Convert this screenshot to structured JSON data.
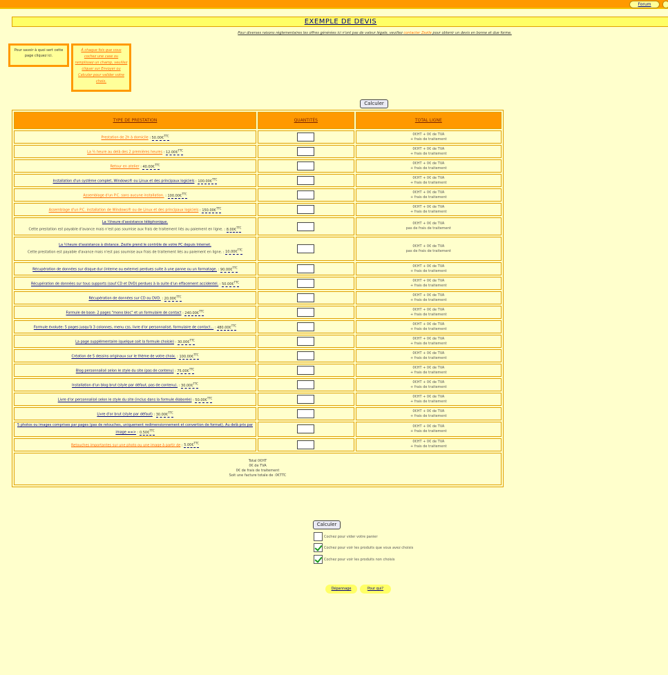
{
  "topbar": {
    "forum": "Forum"
  },
  "title": "EXEMPLE DE DEVIS",
  "note": {
    "before": "Pour diverses raisons réglementaires les offres générées ici n'ont pas de valeur légale, veuillez",
    "link": "contacter Zezile",
    "after": "pour obtenir un devis en bonne et due forme."
  },
  "help_box": "Pour savoir à quoi sert cette page cliquez ici.",
  "instruction_box": "À chaque fois que vous cochez une case ou remplissez un champ, veuillez cliquer sur Envoyer ou Calculer pour valider votre choix.",
  "calc_label": "Calculer",
  "columns": {
    "type": "TYPE DE PRESTATION",
    "qty": "QUANTITÉS",
    "total": "TOTAL LIGNE"
  },
  "rows": [
    {
      "name": "Prestation de 2h à domicile",
      "price": "50.00€",
      "sub": "",
      "color": "orange",
      "total1": "0€HT + 0€ de TVA",
      "total2": "+ frais de traitement"
    },
    {
      "name": "La ½ heure au delà des 2 premières heures",
      "price": "12.00€",
      "sub": "",
      "color": "orange",
      "total1": "0€HT + 0€ de TVA",
      "total2": "+ frais de traitement"
    },
    {
      "name": "Retour en atelier",
      "price": "40.00€",
      "sub": "",
      "color": "orange",
      "total1": "0€HT + 0€ de TVA",
      "total2": "+ frais de traitement"
    },
    {
      "name": "Installation d'un système complet, Windows® ou Linux et des principaux logiciels",
      "price": "100.00€",
      "sub": "",
      "color": "blue",
      "total1": "0€HT + 0€ de TVA",
      "total2": "+ frais de traitement"
    },
    {
      "name": "Assemblage d'un P.C. sans aucune installation.",
      "price": "100.00€",
      "sub": "",
      "color": "orange",
      "total1": "0€HT + 0€ de TVA",
      "total2": "+ frais de traitement"
    },
    {
      "name": "Assemblage d'un P.C. installation de Windows® ou de Linux et des principaux logiciels",
      "price": "150.00€",
      "sub": "",
      "color": "orange",
      "total1": "0€HT + 0€ de TVA",
      "total2": "+ frais de traitement"
    },
    {
      "name": "La ½heure d'assistance téléphonique.",
      "price": "8.00€",
      "sub": "Cette prestation est payable d'avance mais n'est pas soumise aux frais de traitement liés au paiement en ligne.",
      "color": "blue",
      "total1": "0€HT + 0€ de TVA",
      "total2": "pas de frais de traitement"
    },
    {
      "name": "La ½heure d'assistance à distance. Zezile prend le contrôle de votre PC depuis Internet.",
      "price": "10.00€",
      "sub": "Cette prestation est payable d'avance mais n'est pas soumise aux frais de traitement liés au paiement en ligne.",
      "color": "blue",
      "total1": "0€HT + 0€ de TVA",
      "total2": "pas de frais de traitement"
    },
    {
      "name": "Récupération de données sur disque dur (interne ou externe) perdues suite à une panne ou un formatage.",
      "price": "90.00€",
      "sub": "",
      "color": "blue",
      "total1": "0€HT + 0€ de TVA",
      "total2": "+ frais de traitement"
    },
    {
      "name": "Récupération de données sur tous supports (sauf CD et DVD) perdues à la suite d'un effacement accidentel.",
      "price": "50.00€",
      "sub": "",
      "color": "blue",
      "total1": "0€HT + 0€ de TVA",
      "total2": "+ frais de traitement"
    },
    {
      "name": "Récupération de données sur CD ou DVD.",
      "price": "20.00€",
      "sub": "",
      "color": "blue",
      "total1": "0€HT + 0€ de TVA",
      "total2": "+ frais de traitement"
    },
    {
      "name": "Formule de base: 2 pages \"mono bloc\" et un formulaire de contact",
      "price": "240.00€",
      "sub": "",
      "color": "blue",
      "total1": "0€HT + 0€ de TVA",
      "total2": "+ frais de traitement"
    },
    {
      "name": "Formule évoluée: 5 pages jusqu'à 3 colonnes, menu css, livre d'or personnalisé, formulaire de contact...",
      "price": "480.00€",
      "sub": "",
      "color": "blue",
      "total1": "0€HT + 0€ de TVA",
      "total2": "+ frais de traitement"
    },
    {
      "name": "La page supplémentaire (quelque soit la formule choisie)",
      "price": "30.00€",
      "sub": "",
      "color": "blue",
      "total1": "0€HT + 0€ de TVA",
      "total2": "+ frais de traitement"
    },
    {
      "name": "Création de 5 dessins originaux sur le thème de votre choix.",
      "price": "100.00€",
      "sub": "",
      "color": "blue",
      "total1": "0€HT + 0€ de TVA",
      "total2": "+ frais de traitement"
    },
    {
      "name": "Blog personnalisé selon le style du site (pas de contenu)",
      "price": "75.00€",
      "sub": "",
      "color": "blue",
      "total1": "0€HT + 0€ de TVA",
      "total2": "+ frais de traitement"
    },
    {
      "name": "Installation d'un blog brut (style par défaut, pas de contenu).",
      "price": "30.00€",
      "sub": "",
      "color": "blue",
      "total1": "0€HT + 0€ de TVA",
      "total2": "+ frais de traitement"
    },
    {
      "name": "Livre d'or personnalisé selon le style du site (inclus dans la formule élaborée)",
      "price": "50.00€",
      "sub": "",
      "color": "blue",
      "total1": "0€HT + 0€ de TVA",
      "total2": "+ frais de traitement"
    },
    {
      "name": "Livre d'or brut (style par défaut)",
      "price": "30.00€",
      "sub": "",
      "color": "blue",
      "total1": "0€HT + 0€ de TVA",
      "total2": "+ frais de traitement"
    },
    {
      "name": "5 photos ou images comprises par pages (pas de retouches, uniquement redimensionnement et convertion de format). Au delà prix par image ==>",
      "price": "0.50€",
      "sub": "",
      "color": "blue",
      "total1": "0€HT + 0€ de TVA",
      "total2": "+ frais de traitement"
    },
    {
      "name": "Retouches importantes sur une photo ou une image à partir de",
      "price": "5.00€",
      "sub": "",
      "color": "orange",
      "total1": "0€HT + 0€ de TVA",
      "total2": "+ frais de traitement"
    }
  ],
  "ttc": "TTC",
  "summary": {
    "line1": "Total 0€HT",
    "line2": "0€ de TVA",
    "line3": "0€ de frais de traitement",
    "line4": "Soit une facture totale de :0€TTC"
  },
  "options": [
    {
      "label": "Cochez pour vider votre panier",
      "checked": false
    },
    {
      "label": "Cochez pour voir les produits que vous avez choisis",
      "checked": true
    },
    {
      "label": "Cochez pour voir les produits non choisis",
      "checked": true
    }
  ],
  "footer": {
    "depannage": "Dépannage",
    "pourquoi": "Pour qui?"
  }
}
